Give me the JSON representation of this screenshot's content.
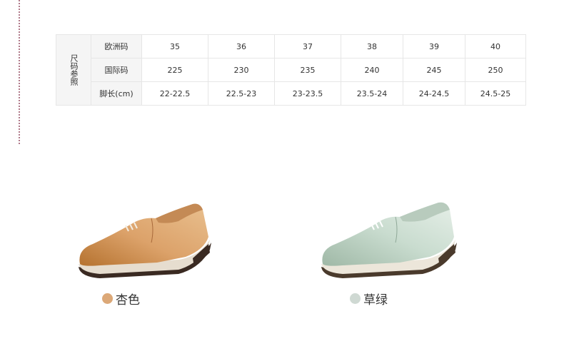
{
  "size_chart": {
    "side_label": "尺码参照",
    "rows": [
      {
        "header": "欧洲码",
        "values": [
          "35",
          "36",
          "37",
          "38",
          "39",
          "40"
        ]
      },
      {
        "header": "国际码",
        "values": [
          "225",
          "230",
          "235",
          "240",
          "245",
          "250"
        ]
      },
      {
        "header": "脚长(cm)",
        "values": [
          "22-22.5",
          "22.5-23",
          "23-23.5",
          "23.5-24",
          "24-24.5",
          "24.5-25"
        ]
      }
    ]
  },
  "variants": [
    {
      "name": "杏色",
      "swatch_color": "#dca877",
      "icon": "shoe-apricot-icon"
    },
    {
      "name": "草绿",
      "swatch_color": "#cfd9d3",
      "icon": "shoe-grass-green-icon"
    }
  ]
}
